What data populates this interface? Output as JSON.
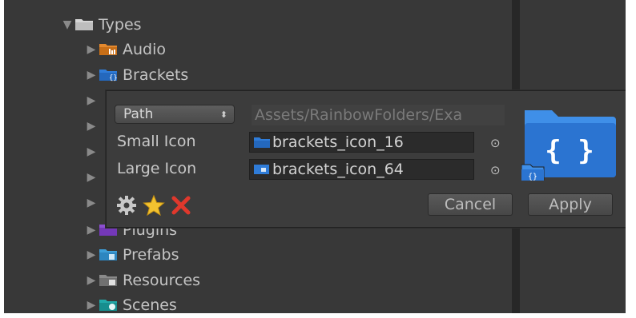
{
  "tree": {
    "types": {
      "label": "Types"
    },
    "items": [
      {
        "label": "Audio",
        "icon": "audio-folder-icon",
        "color": "#e4892e"
      },
      {
        "label": "Brackets",
        "icon": "brackets-folder-icon",
        "color": "#2f7cd8"
      },
      {
        "label": "Plugins",
        "icon": "plugins-folder-icon",
        "color": "#8c4fd0"
      },
      {
        "label": "Prefabs",
        "icon": "prefabs-folder-icon",
        "color": "#3d9ed8"
      },
      {
        "label": "Resources",
        "icon": "resources-folder-icon",
        "color": "#8a8a8a"
      },
      {
        "label": "Scenes",
        "icon": "scenes-folder-icon",
        "color": "#21a9a9"
      }
    ]
  },
  "popup": {
    "key_type": "Path",
    "path_value": "Assets/RainbowFolders/Exa",
    "small_icon_label": "Small Icon",
    "small_icon_value": "brackets_icon_16",
    "large_icon_label": "Large Icon",
    "large_icon_value": "brackets_icon_64",
    "picker_glyph": "⊙",
    "cancel_label": "Cancel",
    "apply_label": "Apply",
    "preview_glyph": "{ }",
    "small_glyph": "{}"
  },
  "colors": {
    "background": "#383838",
    "popup": "#3c3c3c",
    "folder_blue": "#2f7cd8",
    "star": "#f2c230",
    "delete": "#e0382c"
  }
}
